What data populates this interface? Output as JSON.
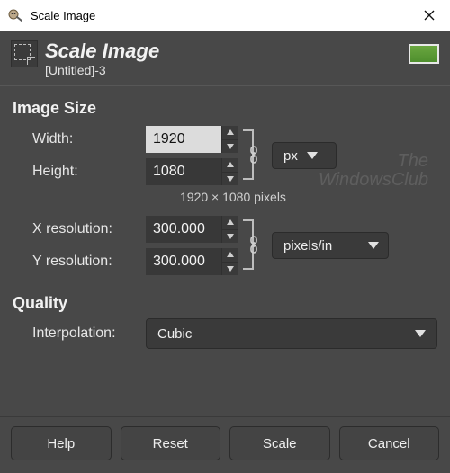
{
  "window": {
    "title": "Scale Image"
  },
  "header": {
    "title": "Scale Image",
    "subtitle": "[Untitled]-3"
  },
  "imageSize": {
    "heading": "Image Size",
    "widthLabel": "Width:",
    "heightLabel": "Height:",
    "width": "1920",
    "height": "1080",
    "unit": "px",
    "pixelHint": "1920 × 1080 pixels",
    "xresLabel": "X resolution:",
    "yresLabel": "Y resolution:",
    "xres": "300.000",
    "yres": "300.000",
    "resUnit": "pixels/in"
  },
  "quality": {
    "heading": "Quality",
    "interpLabel": "Interpolation:"
  },
  "interp": {
    "value": "Cubic"
  },
  "buttons": {
    "help": "Help",
    "reset": "Reset",
    "scale": "Scale",
    "cancel": "Cancel"
  },
  "watermark": {
    "l1": "The",
    "l2": "WindowsClub"
  }
}
